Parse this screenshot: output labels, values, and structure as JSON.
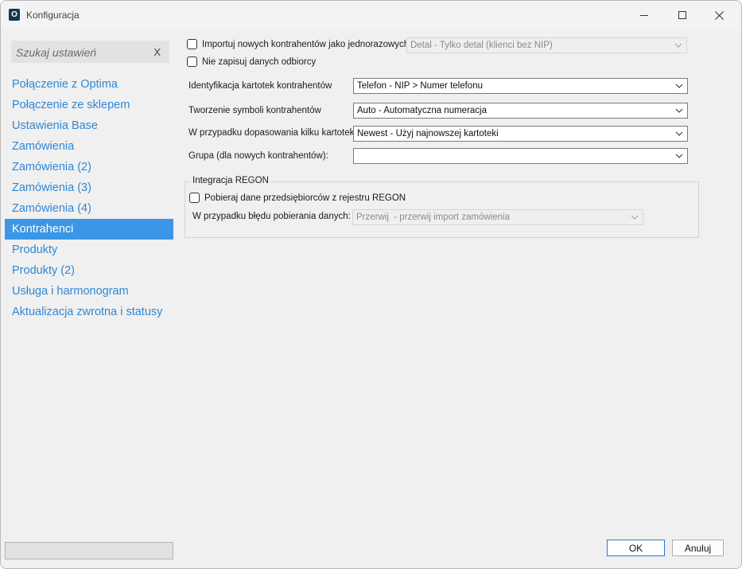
{
  "window": {
    "title": "Konfiguracja",
    "app_icon_letter": "O"
  },
  "search": {
    "placeholder": "Szukaj ustawień",
    "clear_label": "X"
  },
  "sidebar": {
    "items": [
      {
        "label": "Połączenie z Optima",
        "active": false
      },
      {
        "label": "Połączenie ze sklepem",
        "active": false
      },
      {
        "label": "Ustawienia Base",
        "active": false
      },
      {
        "label": "Zamówienia",
        "active": false
      },
      {
        "label": "Zamówienia (2)",
        "active": false
      },
      {
        "label": "Zamówienia (3)",
        "active": false
      },
      {
        "label": "Zamówienia (4)",
        "active": false
      },
      {
        "label": "Kontrahenci",
        "active": true
      },
      {
        "label": "Produkty",
        "active": false
      },
      {
        "label": "Produkty (2)",
        "active": false
      },
      {
        "label": "Usługa i harmonogram",
        "active": false
      },
      {
        "label": "Aktualizacja zwrotna i statusy",
        "active": false
      }
    ]
  },
  "settings": {
    "import_oneoff": {
      "label": "Importuj nowych kontrahentów jako jednorazowych",
      "checked": false,
      "select_value": "Detal - Tylko detal (klienci bez NIP)"
    },
    "no_save_recipient": {
      "label": "Nie zapisuj danych odbiorcy",
      "checked": false
    },
    "identification": {
      "label": "Identyfikacja kartotek kontrahentów",
      "value": "Telefon - NIP > Numer telefonu"
    },
    "symbols": {
      "label": "Tworzenie symboli kontrahentów",
      "value": "Auto - Automatyczna numeracja"
    },
    "multi_match": {
      "label": "W przypadku dopasowania kilku kartotek",
      "value": "Newest - Użyj najnowszej kartoteki"
    },
    "group": {
      "label": "Grupa (dla nowych kontrahentów):",
      "value": ""
    }
  },
  "regon": {
    "legend": "Integracja REGON",
    "fetch_label": "Pobieraj dane przedsiębiorców z rejestru REGON",
    "fetch_checked": false,
    "error_label": "W przypadku błędu pobierania danych:",
    "error_value": "Przerwij  - przerwij import zamówienia"
  },
  "buttons": {
    "ok": "OK",
    "cancel": "Anuluj"
  },
  "colors": {
    "accent": "#3c96e6",
    "link": "#2e87d6",
    "background": "#f0f0f0"
  }
}
